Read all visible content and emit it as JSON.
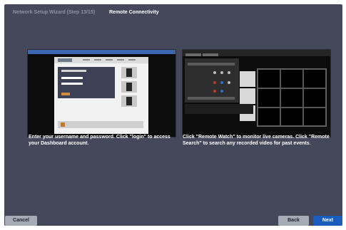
{
  "header": {
    "step": "Network Setup Wizard (Step 13/15)",
    "title": "Remote Connectivity"
  },
  "left": {
    "caption": "Enter your username and password. Click \"login\" to access your Dashboard account."
  },
  "right": {
    "caption": "Click \"Remote Watch\" to monitor live cameras. Click \"Remote Search\" to search any recorded video for past events."
  },
  "footer": {
    "cancel_label": "Cancel",
    "back_label": "Back",
    "next_label": "Next"
  },
  "colors": {
    "background": "#44485a",
    "next_button": "#1b5dbe",
    "secondary_button": "#a7abb6"
  }
}
